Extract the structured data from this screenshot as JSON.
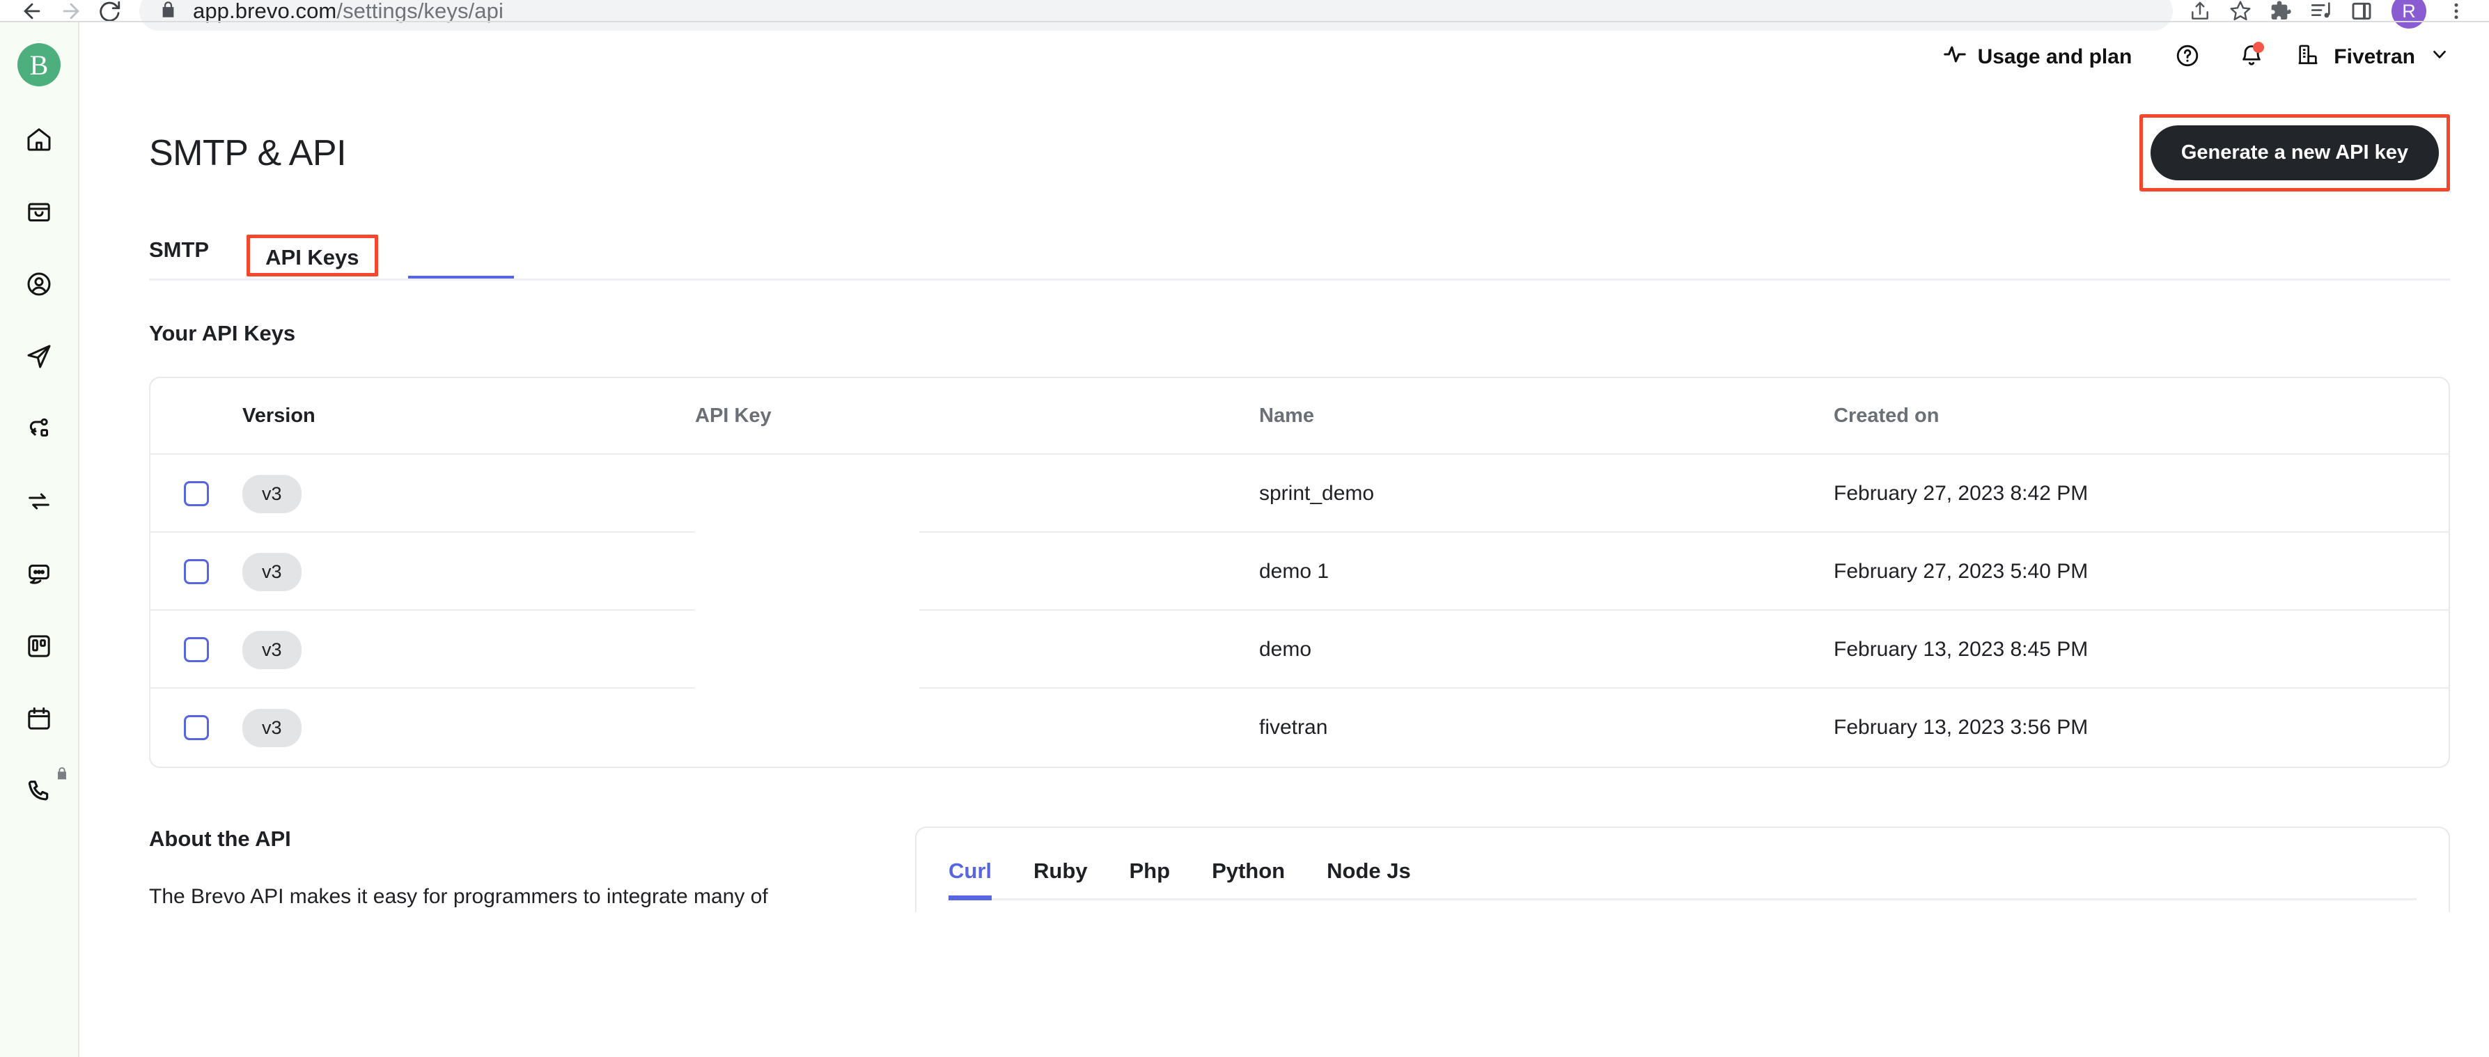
{
  "browser": {
    "url_host": "app.brevo.com",
    "url_path": "/settings/keys/api",
    "back_icon": "back-arrow-icon",
    "forward_icon": "forward-arrow-icon",
    "reload_icon": "reload-icon",
    "lock_icon": "lock-icon",
    "share_icon": "share-icon",
    "bookmark_icon": "star-icon",
    "extensions_icon": "puzzle-icon",
    "media_icon": "music-playlist-icon",
    "panel_icon": "side-panel-icon",
    "avatar_label": "R",
    "menu_icon": "three-dot-menu-icon"
  },
  "sidebar": {
    "brand": "B",
    "items": [
      {
        "icon": "home-icon",
        "name": "home"
      },
      {
        "icon": "shopping-bag-icon",
        "name": "commerce"
      },
      {
        "icon": "user-circle-icon",
        "name": "contacts"
      },
      {
        "icon": "paper-plane-icon",
        "name": "campaigns"
      },
      {
        "icon": "automation-node-icon",
        "name": "automation"
      },
      {
        "icon": "sync-arrows-icon",
        "name": "sync"
      },
      {
        "icon": "chat-bubble-icon",
        "name": "conversations"
      },
      {
        "icon": "kanban-board-icon",
        "name": "deals"
      },
      {
        "icon": "calendar-icon",
        "name": "meetings"
      },
      {
        "icon": "phone-icon",
        "name": "phone",
        "locked": true
      }
    ]
  },
  "header": {
    "usage_label": "Usage and plan",
    "usage_icon": "activity-pulse-icon",
    "help_icon": "help-circle-icon",
    "notifications_icon": "bell-icon",
    "org_icon": "building-icon",
    "org_name": "Fivetran",
    "chevron_icon": "chevron-down-icon",
    "notification_dot_color": "#f4564a"
  },
  "page": {
    "title": "SMTP & API",
    "generate_button": "Generate a new API key",
    "highlight_color": "#f4472c",
    "accent_color": "#5766e0",
    "tabs": [
      {
        "label": "SMTP",
        "active": false
      },
      {
        "label": "API Keys",
        "active": true
      }
    ]
  },
  "keys_section": {
    "heading": "Your API Keys",
    "columns": [
      "Version",
      "API Key",
      "Name",
      "Created on"
    ],
    "rows": [
      {
        "version": "v3",
        "api_key": "",
        "name": "sprint_demo",
        "created_on": "February 27, 2023 8:42 PM",
        "checked": false
      },
      {
        "version": "v3",
        "api_key": "",
        "name": "demo 1",
        "created_on": "February 27, 2023 5:40 PM",
        "checked": false
      },
      {
        "version": "v3",
        "api_key": "",
        "name": "demo",
        "created_on": "February 13, 2023 8:45 PM",
        "checked": false
      },
      {
        "version": "v3",
        "api_key": "",
        "name": "fivetran",
        "created_on": "February 13, 2023 3:56 PM",
        "checked": false
      }
    ]
  },
  "about": {
    "title": "About the API",
    "body": "The Brevo API makes it easy for programmers to integrate many of"
  },
  "code": {
    "tabs": [
      {
        "label": "Curl",
        "active": true
      },
      {
        "label": "Ruby",
        "active": false
      },
      {
        "label": "Php",
        "active": false
      },
      {
        "label": "Python",
        "active": false
      },
      {
        "label": "Node Js",
        "active": false
      }
    ]
  }
}
